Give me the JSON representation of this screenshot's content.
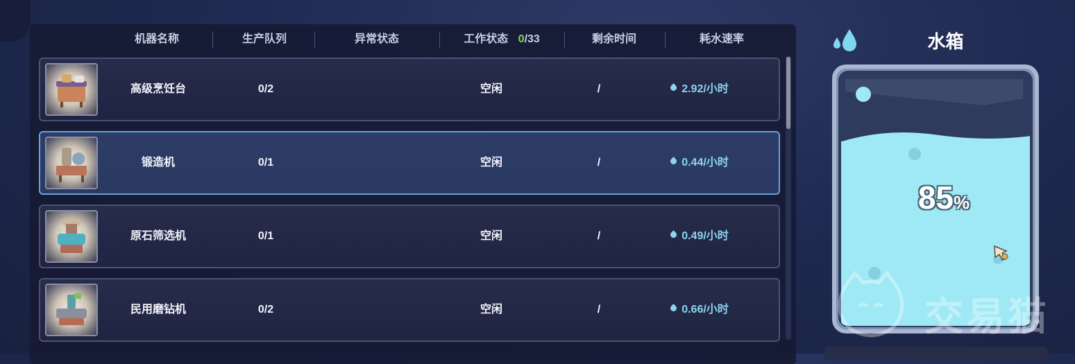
{
  "table": {
    "headers": {
      "name": "机器名称",
      "queue": "生产队列",
      "abnormal": "异常状态",
      "work": "工作状态",
      "work_count_current": "0",
      "work_count_total": "/33",
      "remaining": "剩余时间",
      "rate": "耗水速率"
    },
    "rows": [
      {
        "name": "高级烹饪台",
        "queue": "0/2",
        "abnormal": "",
        "status": "空闲",
        "remaining": "/",
        "rate": "2.92/小时",
        "selected": false
      },
      {
        "name": "锻造机",
        "queue": "0/1",
        "abnormal": "",
        "status": "空闲",
        "remaining": "/",
        "rate": "0.44/小时",
        "selected": true
      },
      {
        "name": "原石筛选机",
        "queue": "0/1",
        "abnormal": "",
        "status": "空闲",
        "remaining": "/",
        "rate": "0.49/小时",
        "selected": false
      },
      {
        "name": "民用磨钻机",
        "queue": "0/2",
        "abnormal": "",
        "status": "空闲",
        "remaining": "/",
        "rate": "0.66/小时",
        "selected": false
      }
    ]
  },
  "tank": {
    "title": "水箱",
    "percent": "85",
    "percent_sign": "%",
    "fill_fraction": 0.85
  },
  "watermark": {
    "text": "交易猫"
  },
  "colors": {
    "water": "#9fe8f5",
    "accent_green": "#7ed957",
    "rate_blue": "#8fd3f0",
    "selected_border": "#6aa3d8"
  },
  "icons": [
    "water-drop-icon",
    "machine-thumbnail",
    "scroll-thumb",
    "cursor-icon"
  ]
}
